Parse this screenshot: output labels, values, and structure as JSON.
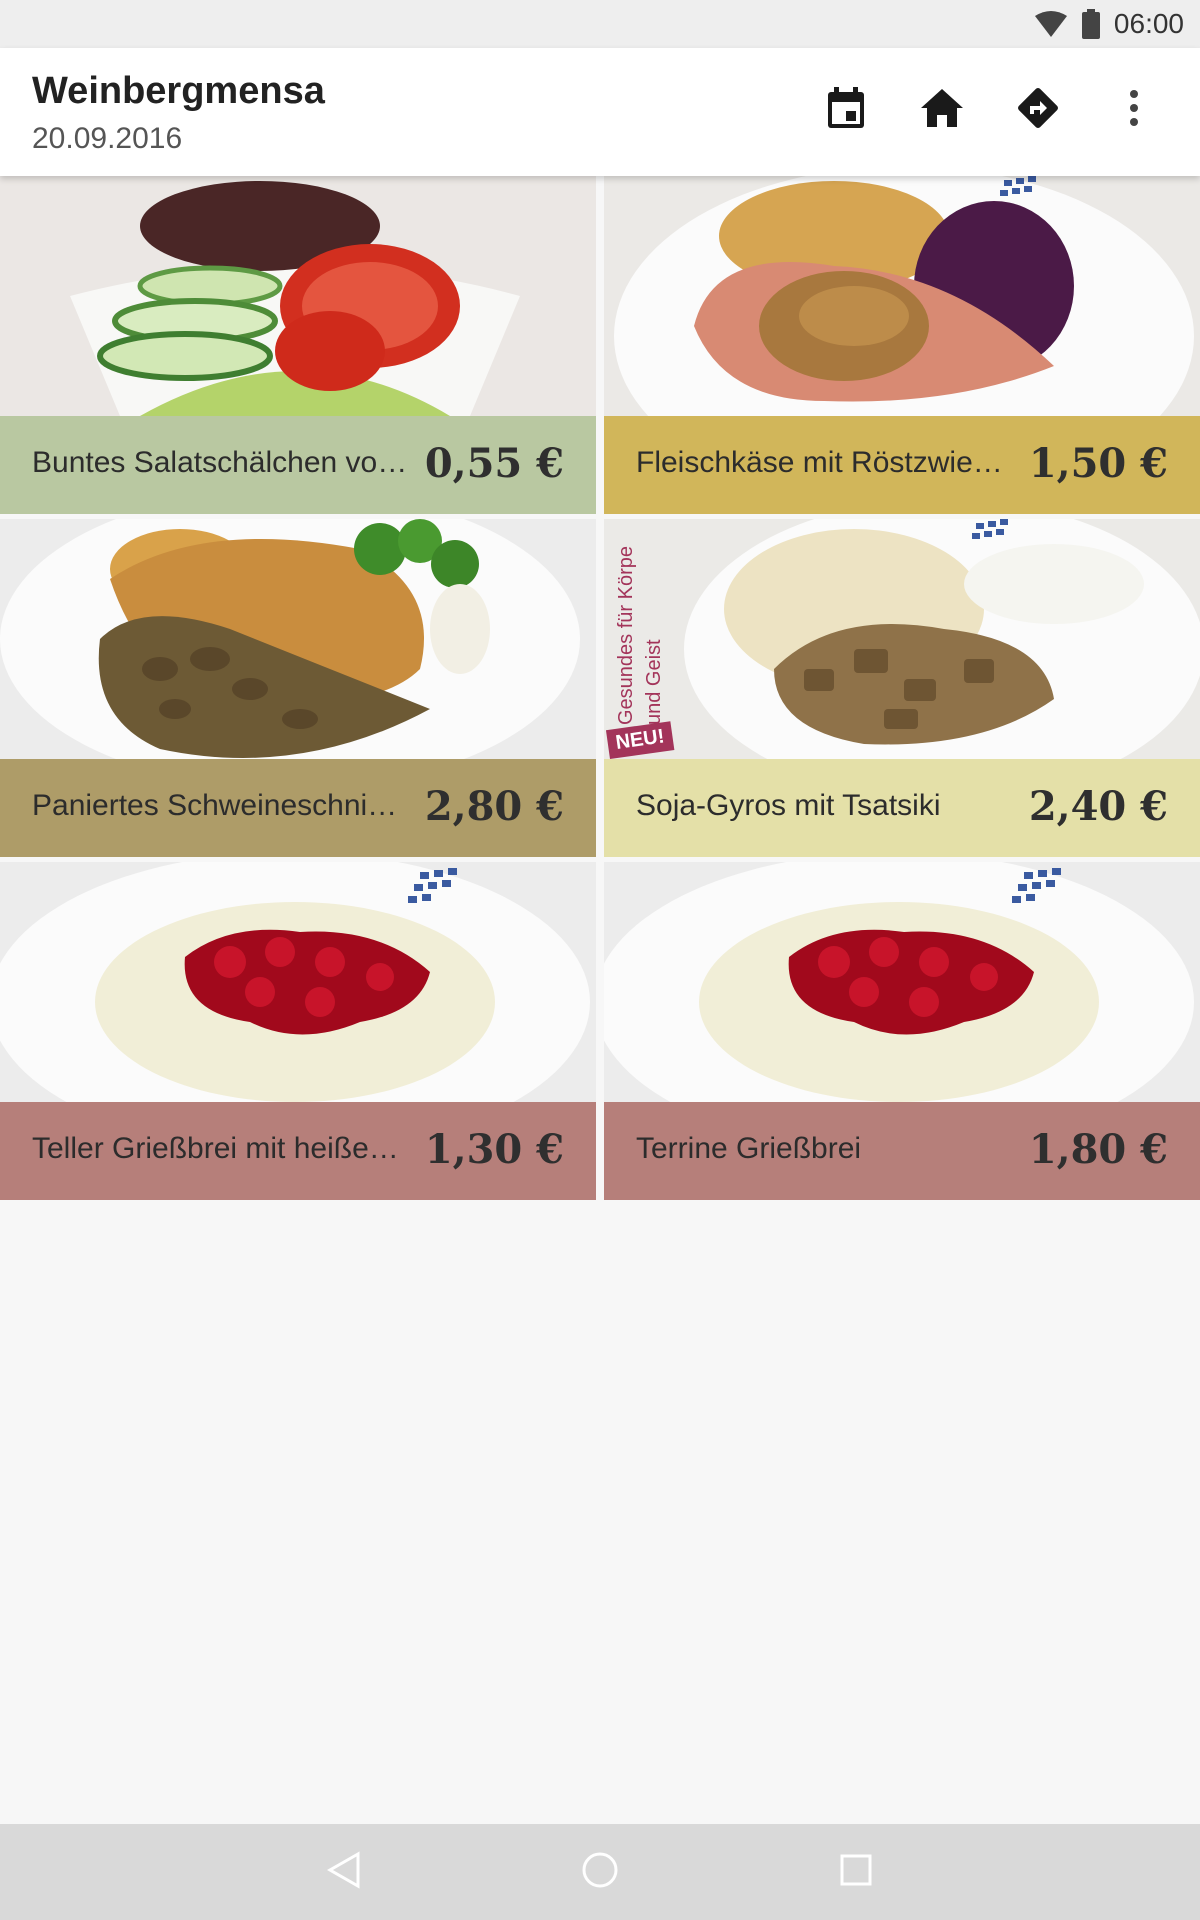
{
  "status_bar": {
    "time": "06:00",
    "icons": [
      "wifi-icon",
      "battery-icon"
    ]
  },
  "app_bar": {
    "title": "Weinbergmensa",
    "date": "20.09.2016",
    "actions": [
      "calendar-icon",
      "home-icon",
      "directions-icon",
      "more-vert-icon"
    ]
  },
  "meals": [
    {
      "name": "Buntes Salatschälchen vo…",
      "price": "0,55 €",
      "color": "#b9c8a1",
      "photo": "salad"
    },
    {
      "name": "Fleischkäse mit Röstzwie…",
      "price": "1,50 €",
      "color": "#d1b65a",
      "photo": "fleischkaese"
    },
    {
      "name": "Paniertes Schweineschni…",
      "price": "2,80 €",
      "color": "#ae9c68",
      "photo": "schnitzel"
    },
    {
      "name": "Soja-Gyros mit Tsatsiki",
      "price": "2,40 €",
      "color": "#e4e0a8",
      "photo": "gyros",
      "side_text": [
        "Gesundes für Körpe",
        "und Geist"
      ],
      "badge": "NEU!"
    },
    {
      "name": "Teller Grießbrei mit heiße…",
      "price": "1,30 €",
      "color": "#b67f7a",
      "photo": "griess"
    },
    {
      "name": "Terrine Grießbrei",
      "price": "1,80 €",
      "color": "#b67f7a",
      "photo": "griess"
    }
  ],
  "nav_bar": {
    "buttons": [
      "back-icon",
      "home-circle-icon",
      "recents-icon"
    ]
  }
}
